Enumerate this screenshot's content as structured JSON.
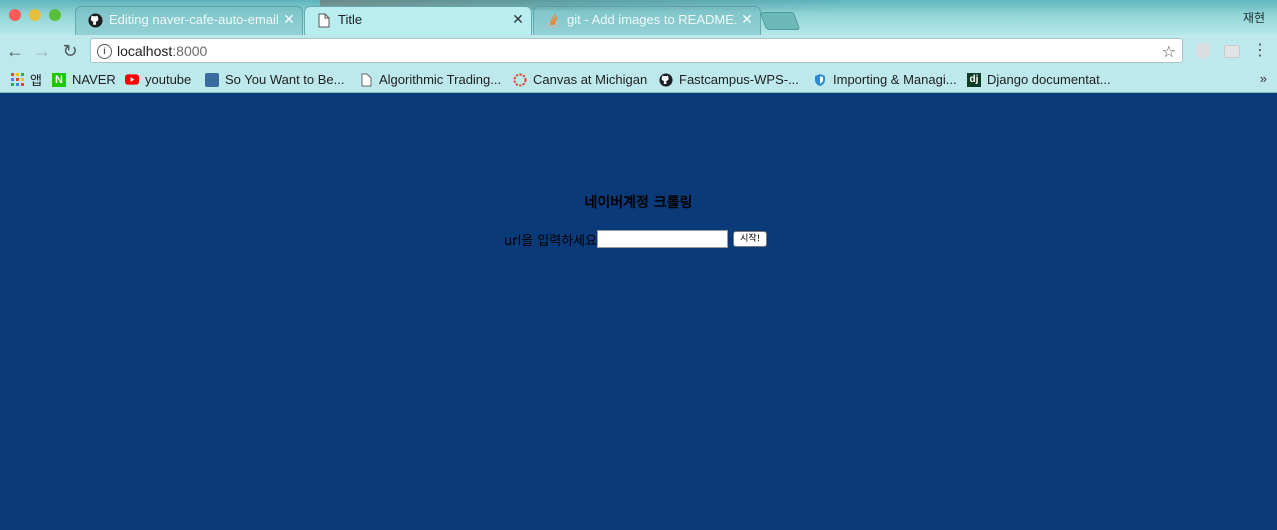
{
  "browser": {
    "tabs": [
      {
        "title": "Editing naver-cafe-auto-emaili",
        "icon": "github-icon",
        "active": false
      },
      {
        "title": "Title",
        "icon": "document-icon",
        "active": true
      },
      {
        "title": "git - Add images to README.m",
        "icon": "stackoverflow-icon",
        "active": false
      }
    ],
    "profile_name": "재현",
    "address": {
      "host": "localhost",
      "port": ":8000"
    },
    "bookmarks": [
      {
        "label": "앱",
        "icon": "apps-grid-icon"
      },
      {
        "label": "NAVER",
        "icon": "naver-icon"
      },
      {
        "label": "youtube",
        "icon": "youtube-icon"
      },
      {
        "label": "So You Want to Be...",
        "icon": "site-icon"
      },
      {
        "label": "Algorithmic Trading...",
        "icon": "document-icon"
      },
      {
        "label": "Canvas at Michigan",
        "icon": "canvas-icon"
      },
      {
        "label": "Fastcampus-WPS-...",
        "icon": "github-icon"
      },
      {
        "label": "Importing & Managi...",
        "icon": "shield-icon"
      },
      {
        "label": "Django documentat...",
        "icon": "django-icon"
      }
    ],
    "bookmarks_more": "»"
  },
  "page": {
    "heading": "네이버계정 크롤링",
    "url_label": "url을 입력하세요",
    "url_input_value": "",
    "start_button": "시작!"
  },
  "colors": {
    "page_background": "#0a3a78",
    "browser_frame": "#bde9ec"
  }
}
